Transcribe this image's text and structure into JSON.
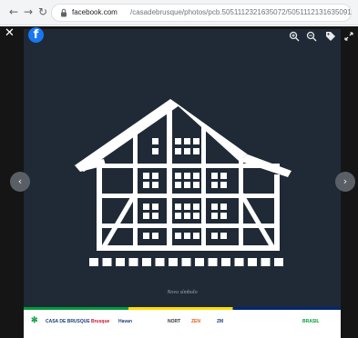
{
  "browser": {
    "back_icon": "back-arrow-icon",
    "forward_icon": "forward-arrow-icon",
    "reload_icon": "reload-icon",
    "url_host": "facebook.com",
    "url_path": "/casadebrusque/photos/pcb.5051112321635072/5051112131635091"
  },
  "viewer": {
    "close_icon": "close-icon",
    "logo": "f",
    "tools": [
      "zoom-in-icon",
      "zoom-out-icon",
      "tag-icon",
      "fullscreen-icon"
    ],
    "prev_arrow": "‹",
    "next_arrow": "›"
  },
  "photo": {
    "background_color": "#1f2a36",
    "caption": "Novo símbolo",
    "sponsors": [
      {
        "text": "CASA DE BRUSQUE",
        "color": "#1b3f7a"
      },
      {
        "text": "Brusque",
        "color": "#c8102e"
      },
      {
        "text": "Havan",
        "color": "#1b3f7a"
      },
      {
        "text": "NORT",
        "color": "#333333"
      },
      {
        "text": "ZEN",
        "color": "#e85a12"
      },
      {
        "text": "ZM",
        "color": "#1b3f7a"
      },
      {
        "text": "BRASIL",
        "color": "#009c3b"
      }
    ]
  }
}
